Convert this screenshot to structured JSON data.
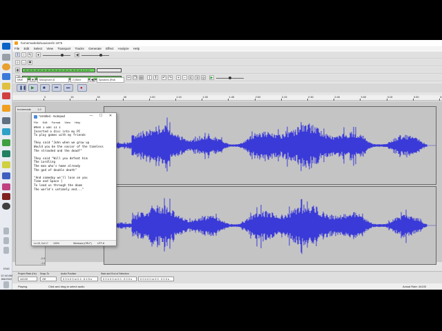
{
  "app": {
    "title": "homemadedahuaxianshi 1975",
    "menu": [
      "File",
      "Edit",
      "Select",
      "View",
      "Transport",
      "Tracks",
      "Generate",
      "Effect",
      "Analyze",
      "Help"
    ]
  },
  "toolbar": {
    "meter_record": "-57 -54 -51 -48 -45 -42 -39 -36 -33 -30 -27 -24 -21 -18 -15 -12 -9 -6 -3 0",
    "meter_play": "-57 -54 -51 -48 -45 -42 -39 Click to Start Monitoring 1 -18 -15 -12 -9 -6 -3 0",
    "host": "MME",
    "rec_device": "Microphone (6",
    "channels": "2 (Stere",
    "play_device": "Speakers (Real"
  },
  "ruler": {
    "ticks": [
      "0",
      "15",
      "30",
      "45",
      "1:00",
      "1:15",
      "1:30",
      "1:45",
      "2:00",
      "2:15",
      "2:30",
      "2:45",
      "3:00",
      "3:15",
      "3:30",
      "3:45"
    ]
  },
  "track": {
    "name": "homemade",
    "gain": "1.0",
    "scale_bottom": [
      "-0.5",
      "-1.0"
    ]
  },
  "notepad": {
    "title": "*Untitled - Notepad",
    "menu": [
      "File",
      "Edit",
      "Format",
      "View",
      "Help"
    ],
    "lines": [
      "When I was 11 I",
      "Inserted a disc into my PC",
      "To play games with my friends",
      "",
      "They said \"John when we grow up",
      "Would you be the savior of the timeless",
      "The stranded and the dead?\"",
      "",
      "They said \"Will you defeat him",
      "The Lordling",
      "The man who's home already",
      "The god of double death\"",
      "",
      "\"And someday we'll lose on you",
      "Time and Space ]",
      "To lead us through the doom",
      "The world's untimely end...\""
    ],
    "status_pos": "Ln 15, Col 17",
    "status_zoom": "100%",
    "status_eol": "Windows (CRLF)",
    "status_enc": "UTF-8"
  },
  "selection": {
    "rate_label": "Project Rate (Hz)",
    "rate_value": "44100",
    "snap_label": "Snap-To",
    "snap_value": "Off",
    "audio_pos_label": "Audio Position",
    "audio_pos_value": "0 0 h 0 0 m 0 4 . 6 4 5 s",
    "sel_label": "Start and End of Selection",
    "sel_start": "0 0 h 0 0 m 0 0 . 0 0 0 s",
    "sel_end": "0 0 h 0 0 m 0 0 . 0 0 0 s"
  },
  "status": {
    "state": "Playing.",
    "hint": "Click and drag to select audio",
    "actual_rate": "Actual Rate: 44100"
  },
  "clock": {
    "time": "12:44 AM",
    "date": "8/6/2022",
    "lang": "ENG"
  },
  "colors": {
    "waveform": "#3a3ad8",
    "wave_bg": "#c4c4c4",
    "meter_green": "#6ad45a"
  }
}
